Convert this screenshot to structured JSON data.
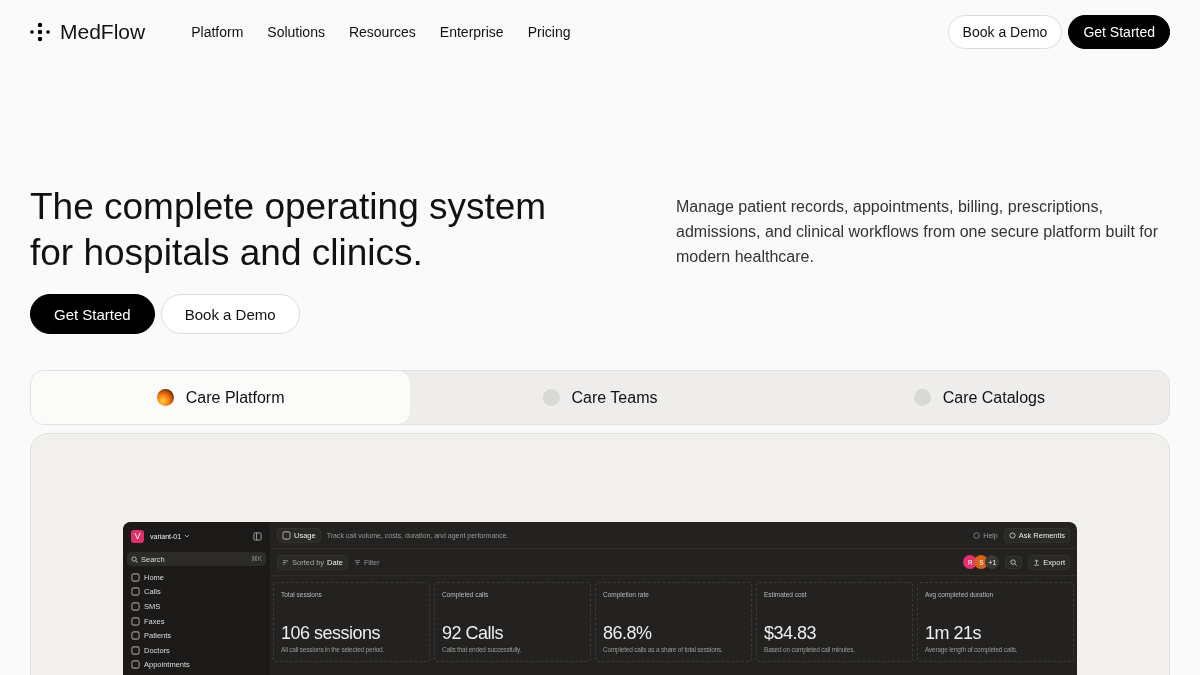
{
  "nav": {
    "brand": "MedFlow",
    "links": [
      "Platform",
      "Solutions",
      "Resources",
      "Enterprise",
      "Pricing"
    ],
    "demo_button": "Book a Demo",
    "start_button": "Get Started"
  },
  "hero": {
    "title": "The complete operating system for hospitals and clinics.",
    "description": "Manage patient records, appointments, billing, prescriptions, admissions, and clinical workflows from one secure platform built for modern healthcare.",
    "start_button": "Get Started",
    "demo_button": "Book a Demo"
  },
  "tabs": [
    {
      "label": "Care Platform",
      "selected": true
    },
    {
      "label": "Care Teams",
      "selected": false
    },
    {
      "label": "Care Catalogs",
      "selected": false
    }
  ],
  "app": {
    "workspace_initial": "V",
    "workspace": "variant-01",
    "search": {
      "placeholder": "Search",
      "shortcut": "⌘K"
    },
    "sidebar": [
      {
        "label": "Home"
      },
      {
        "label": "Calls"
      },
      {
        "label": "SMS"
      },
      {
        "label": "Faxes"
      },
      {
        "label": "Patients"
      },
      {
        "label": "Doctors"
      },
      {
        "label": "Appointments"
      }
    ],
    "page_tag": "Usage",
    "page_description": "Track call volume, costs, duration, and agent performance.",
    "help": "Help",
    "ask": "Ask Rementis",
    "sort_prefix": "Sorted by",
    "sort_value": "Date",
    "filter": "Filter",
    "avatars": [
      {
        "initial": "R",
        "color": "#e0306e"
      },
      {
        "initial": "S",
        "color": "#d4621a"
      }
    ],
    "avatar_more": "+1",
    "export": "Export",
    "metrics": [
      {
        "label": "Total sessions",
        "value": "106 sessions",
        "note": "All call sessions in the selected period."
      },
      {
        "label": "Completed calls",
        "value": "92 Calls",
        "note": "Calls that ended successfully."
      },
      {
        "label": "Completion rate",
        "value": "86.8%",
        "note": "Completed calls as a share of total sessions."
      },
      {
        "label": "Estimated cost",
        "value": "$34.83",
        "note": "Based on completed call minutes."
      },
      {
        "label": "Avg completed duration",
        "value": "1m 21s",
        "note": "Average length of completed calls."
      }
    ]
  }
}
